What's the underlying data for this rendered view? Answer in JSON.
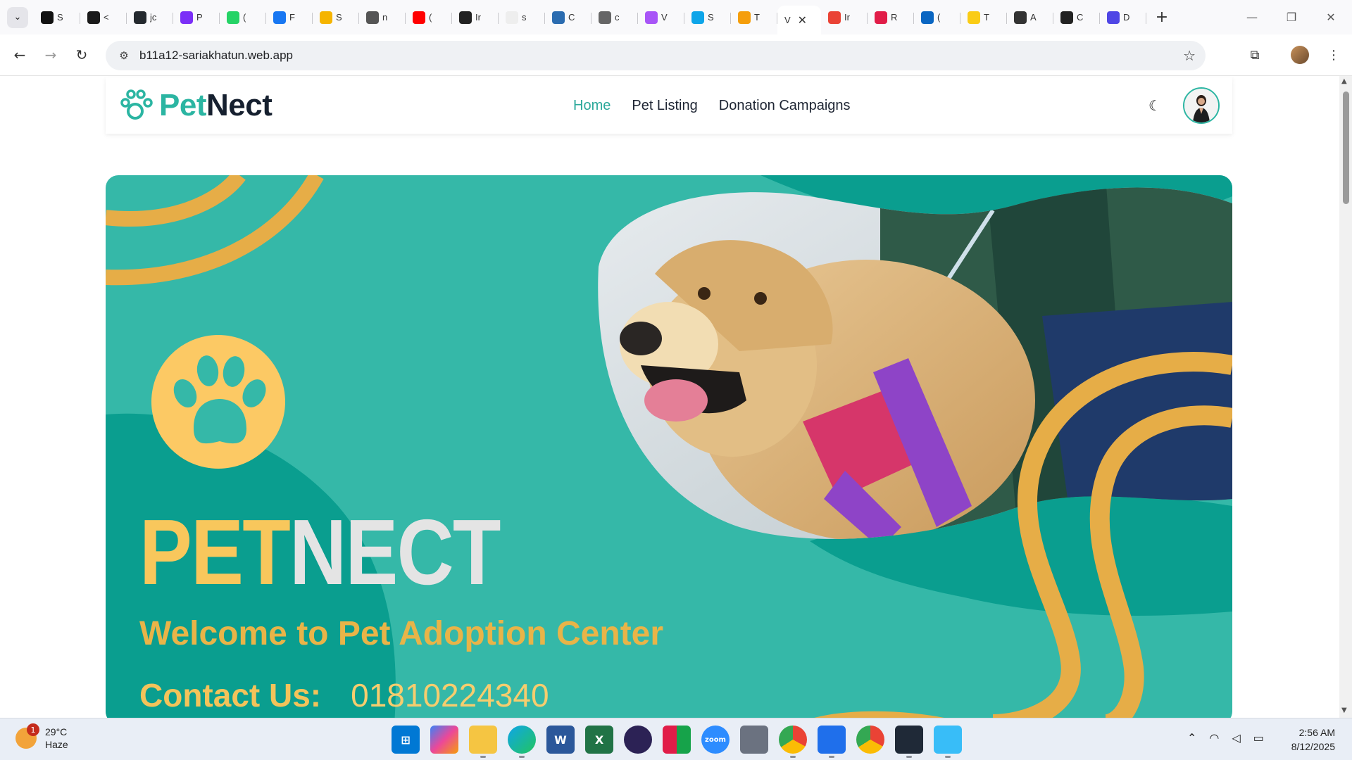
{
  "browser": {
    "tabs": [
      {
        "letter": "S",
        "icon": "stack-icon",
        "color": "#111111"
      },
      {
        "letter": "<",
        "icon": "code-icon",
        "color": "#1a1a1a"
      },
      {
        "letter": "jc",
        "icon": "github-icon",
        "color": "#24292e"
      },
      {
        "letter": "P",
        "icon": "p-app-icon",
        "color": "#7b2ff7"
      },
      {
        "letter": "(",
        "icon": "whatsapp-icon",
        "color": "#25d366"
      },
      {
        "letter": "F",
        "icon": "facebook-icon",
        "color": "#1877f2"
      },
      {
        "letter": "S",
        "icon": "sticker-icon",
        "color": "#f5b400"
      },
      {
        "letter": "n",
        "icon": "w-globe-icon",
        "color": "#555555"
      },
      {
        "letter": "(",
        "icon": "youtube-icon",
        "color": "#ff0000"
      },
      {
        "letter": "Ir",
        "icon": "openai-icon",
        "color": "#222222"
      },
      {
        "letter": "s",
        "icon": "blank-page-icon",
        "color": "#eeeeee"
      },
      {
        "letter": "C",
        "icon": "swirl-icon",
        "color": "#2b6cb0"
      },
      {
        "letter": "c",
        "icon": "globe-icon",
        "color": "#666666"
      },
      {
        "letter": "V",
        "icon": "vite-icon",
        "color": "#a855f7"
      },
      {
        "letter": "S",
        "icon": "c-logo-icon",
        "color": "#0ea5e9"
      },
      {
        "letter": "T",
        "icon": "emoji-icon",
        "color": "#f59e0b"
      }
    ],
    "active_tab": {
      "letter": "V",
      "close": "✕"
    },
    "tabs_after": [
      {
        "letter": "Ir",
        "icon": "gmail-icon",
        "color": "#ea4335"
      },
      {
        "letter": "R",
        "icon": "react-icon",
        "color": "#e11d48"
      },
      {
        "letter": "(",
        "icon": "linkedin-icon",
        "color": "#0a66c2"
      },
      {
        "letter": "T",
        "icon": "yellow-dot-icon",
        "color": "#facc15"
      },
      {
        "letter": "A",
        "icon": "device-icon",
        "color": "#333333"
      },
      {
        "letter": "C",
        "icon": "openai-icon",
        "color": "#222222"
      },
      {
        "letter": "D",
        "icon": "d-logo-icon",
        "color": "#4f46e5"
      }
    ],
    "url": "b11a12-sariakhatun.web.app"
  },
  "site": {
    "logo_part1": "Pet",
    "logo_part2": "Nect",
    "nav": [
      {
        "label": "Home",
        "active": true
      },
      {
        "label": "Pet Listing",
        "active": false
      },
      {
        "label": "Donation Campaigns",
        "active": false
      }
    ],
    "colors": {
      "teal": "#35b8a8",
      "dark_teal": "#0a9e8f",
      "gold": "#e6ad47",
      "paw": "#fcc964"
    }
  },
  "hero": {
    "title_part1": "PET",
    "title_part2": "NECT",
    "welcome": "Welcome to Pet Adoption Center",
    "contact_label": "Contact Us:",
    "contact_number": "01810224340"
  },
  "taskbar": {
    "temperature": "29°C",
    "condition": "Haze",
    "badge": "1",
    "time": "2:56 AM",
    "date": "8/12/2025"
  }
}
